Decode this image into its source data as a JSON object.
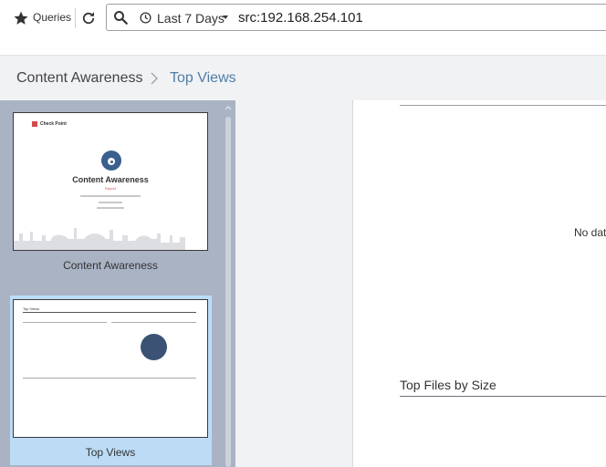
{
  "toolbar": {
    "queries_label": "Queries",
    "time_range": "Last 7 Days",
    "query": "src:192.168.254.101",
    "icons": [
      "star-icon",
      "refresh-icon",
      "search-icon",
      "clock-icon",
      "caret-down-icon"
    ]
  },
  "breadcrumb": {
    "root": "Content Awareness",
    "current": "Top Views"
  },
  "thumbnails": [
    {
      "label": "Content Awareness",
      "selected": false,
      "preview": {
        "brand": "Check Point",
        "title": "Content Awareness",
        "subtitle": "Report"
      }
    },
    {
      "label": "Top Views",
      "selected": true,
      "preview": {
        "title": "Top Views"
      }
    }
  ],
  "report": {
    "no_data": "No dat",
    "section_title": "Top Files by Size"
  },
  "colors": {
    "accent": "#4f7da8",
    "panel": "#a9b3c4",
    "selected": "#bcdcf6",
    "chart_circle": "#3b5275",
    "logo_red": "#d24b4b"
  }
}
